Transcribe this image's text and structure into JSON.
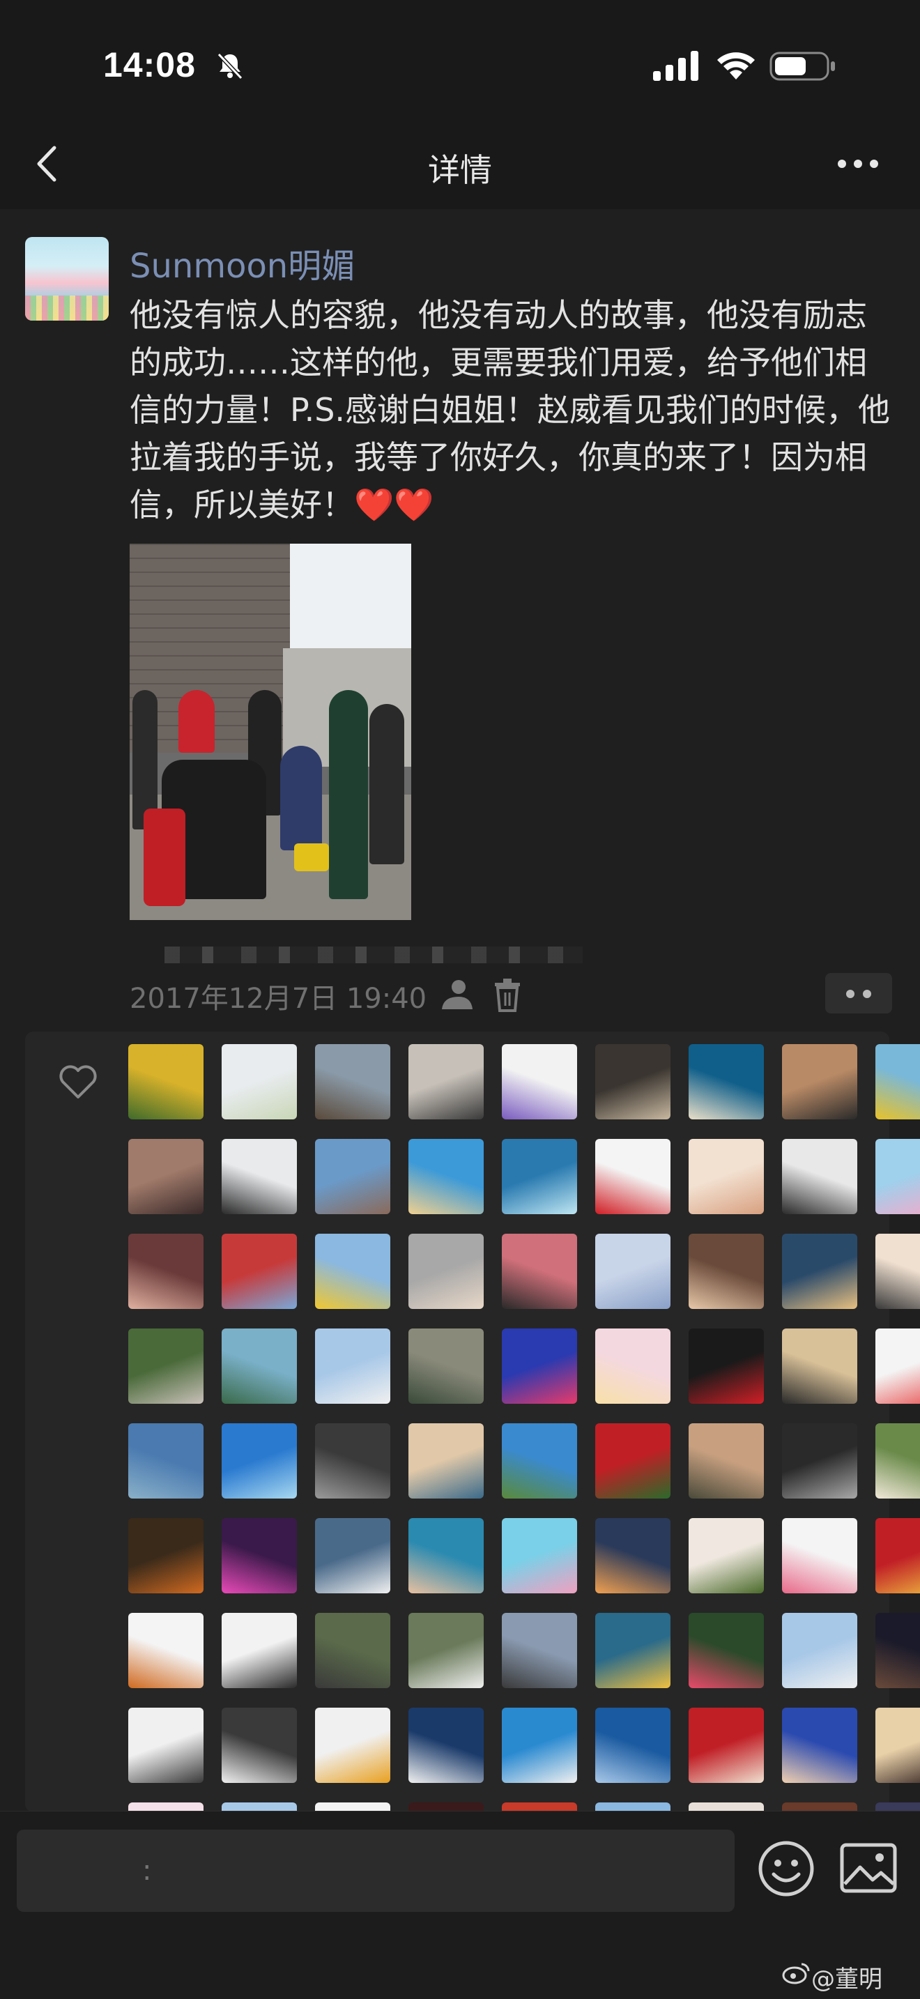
{
  "status_bar": {
    "time": "14:08"
  },
  "nav": {
    "title": "详情"
  },
  "post": {
    "author": "Sunmoon明媚",
    "text": "他没有惊人的容貌，他没有动人的故事，他没有励志的成功……这样的他，更需要我们用爱，给予他们相信的力量！P.S.感谢白姐姐！赵威看见我们的时候，他拉着我的手说，我等了你好久，你真的来了！因为相信，所以美好！",
    "emoji": "❤️❤️",
    "time": "2017年12月7日 19:40"
  },
  "comment_input": {
    "placeholder": ":"
  },
  "watermark": "@董明",
  "colors": {
    "author": "#7b8fb5",
    "background": "#1f1f1f",
    "likes_box": "#262626"
  }
}
